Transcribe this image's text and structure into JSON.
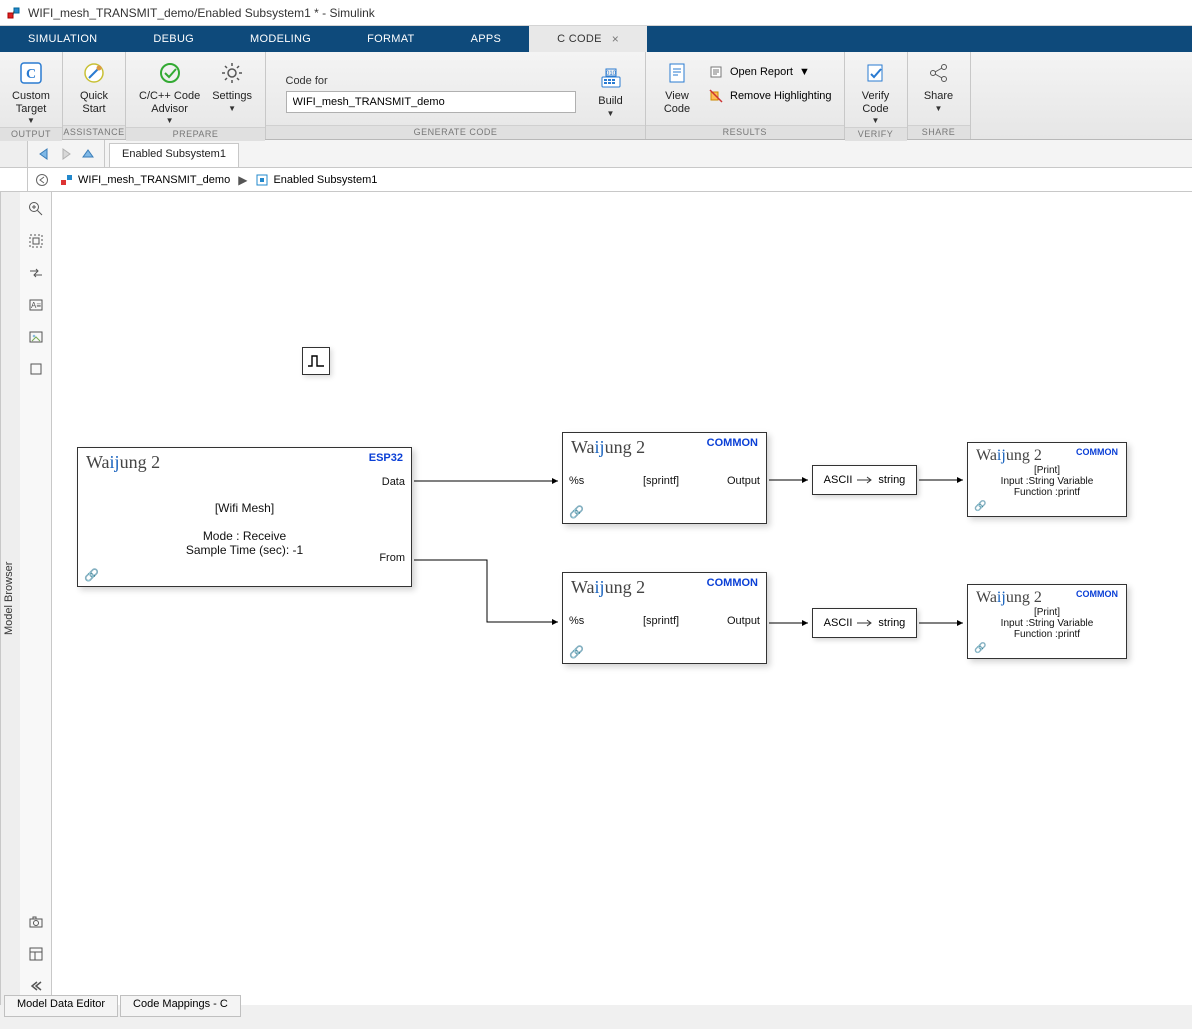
{
  "window": {
    "title": "WIFI_mesh_TRANSMIT_demo/Enabled Subsystem1 * - Simulink"
  },
  "ribbon": {
    "tabs": {
      "simulation": "SIMULATION",
      "debug": "DEBUG",
      "modeling": "MODELING",
      "format": "FORMAT",
      "apps": "APPS",
      "ccode": "C CODE"
    }
  },
  "toolstrip": {
    "output": {
      "label": "OUTPUT",
      "custom_target": "Custom\nTarget"
    },
    "assistance": {
      "label": "ASSISTANCE",
      "quick_start": "Quick\nStart"
    },
    "prepare": {
      "label": "PREPARE",
      "advisor": "C/C++ Code\nAdvisor",
      "settings": "Settings"
    },
    "generate": {
      "label": "GENERATE CODE",
      "code_for": "Code for",
      "code_for_value": "WIFI_mesh_TRANSMIT_demo",
      "build": "Build"
    },
    "results": {
      "label": "RESULTS",
      "view_code": "View\nCode",
      "open_report": "Open Report",
      "remove_highlighting": "Remove Highlighting"
    },
    "verify": {
      "label": "VERIFY",
      "verify_code": "Verify\nCode"
    },
    "share": {
      "label": "SHARE",
      "share": "Share"
    }
  },
  "nav": {
    "path_tab": "Enabled Subsystem1",
    "crumb1": "WIFI_mesh_TRANSMIT_demo",
    "crumb2": "Enabled Subsystem1"
  },
  "sidebar": {
    "model_browser": "Model Browser"
  },
  "blocks": {
    "wifi": {
      "title_pre": "Wa",
      "title_ij": "ij",
      "title_post": "ung 2",
      "tag": "ESP32",
      "name": "[Wifi Mesh]",
      "mode": "Mode : Receive",
      "sample": "Sample Time (sec): -1",
      "port_data": "Data",
      "port_from": "From"
    },
    "sprintf1": {
      "title_pre": "Wa",
      "title_ij": "ij",
      "title_post": "ung 2",
      "tag": "COMMON",
      "in_fmt": "%s",
      "name": "[sprintf]",
      "out": "Output"
    },
    "sprintf2": {
      "title_pre": "Wa",
      "title_ij": "ij",
      "title_post": "ung 2",
      "tag": "COMMON",
      "in_fmt": "%s",
      "name": "[sprintf]",
      "out": "Output"
    },
    "conv": {
      "in": "ASCII",
      "out": "string"
    },
    "print1": {
      "title_pre": "Wa",
      "title_ij": "ij",
      "title_post": "ung 2",
      "tag": "COMMON",
      "l1": "[Print]",
      "l2": "Input :String Variable",
      "l3": "Function :printf"
    },
    "print2": {
      "title_pre": "Wa",
      "title_ij": "ij",
      "title_post": "ung 2",
      "tag": "COMMON",
      "l1": "[Print]",
      "l2": "Input :String Variable",
      "l3": "Function :printf"
    }
  },
  "bottom": {
    "tab1": "Model Data Editor",
    "tab2": "Code Mappings - C"
  }
}
